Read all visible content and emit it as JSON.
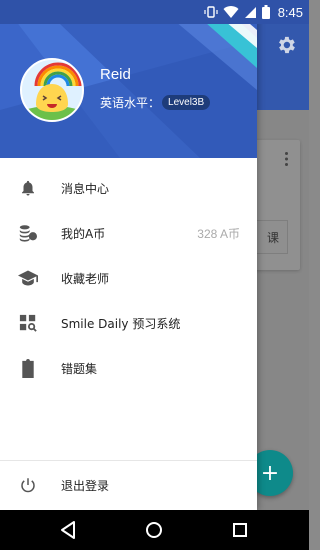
{
  "status_bar": {
    "time": "8:45",
    "icons": [
      "vibrate-icon",
      "wifi-icon",
      "signal-icon",
      "battery-icon"
    ]
  },
  "background_app": {
    "toolbar_icon": "gear-icon",
    "card_button_label": "课",
    "fab_label": "+"
  },
  "drawer": {
    "header": {
      "user_name": "Reid",
      "level_label": "英语水平：",
      "level_value": "Level3B"
    },
    "menu": [
      {
        "label": "消息中心",
        "icon": "bell-icon",
        "value": ""
      },
      {
        "label": "我的A币",
        "icon": "coins-icon",
        "value": "328 A币"
      },
      {
        "label": "收藏老师",
        "icon": "graduation-cap-icon",
        "value": ""
      },
      {
        "label": "Smile Daily 预习系统",
        "icon": "grid-search-icon",
        "value": ""
      },
      {
        "label": "错题集",
        "icon": "clipboard-x-icon",
        "value": ""
      }
    ],
    "logout": {
      "label": "退出登录",
      "icon": "power-icon"
    }
  },
  "nav_bar": {
    "buttons": [
      "back-icon",
      "home-icon",
      "recents-icon"
    ]
  },
  "colors": {
    "header_blue": "#3b66c9",
    "toolbar_blue": "#3358ad",
    "fab_teal": "#0e8a8a",
    "icon_gray": "#555555",
    "accent_cyan": "#38c2d6"
  }
}
